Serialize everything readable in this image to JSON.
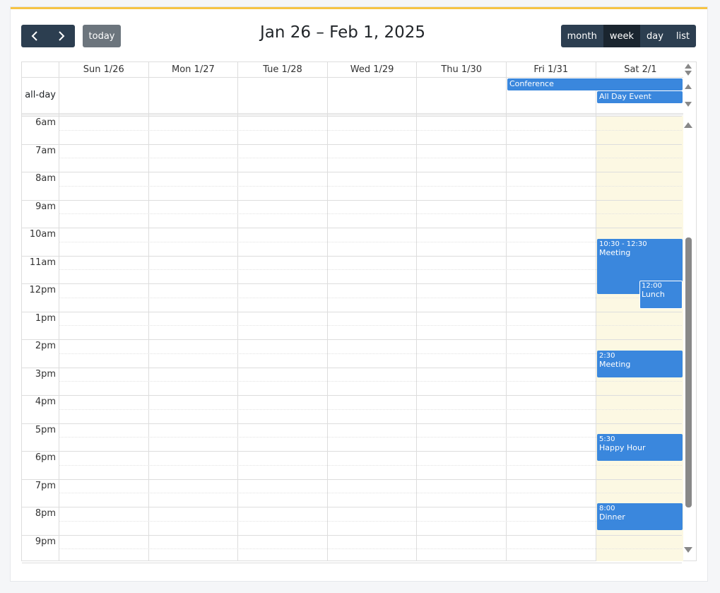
{
  "toolbar": {
    "title": "Jan 26 – Feb 1, 2025",
    "today_label": "today",
    "views": [
      "month",
      "week",
      "day",
      "list"
    ],
    "active_view": "week"
  },
  "columns": [
    "Sun 1/26",
    "Mon 1/27",
    "Tue 1/28",
    "Wed 1/29",
    "Thu 1/30",
    "Fri 1/31",
    "Sat 2/1"
  ],
  "allday_label": "all-day",
  "allday_events": [
    {
      "title": "Conference"
    },
    {
      "title": "All Day Event"
    }
  ],
  "times": [
    "6am",
    "7am",
    "8am",
    "9am",
    "10am",
    "11am",
    "12pm",
    "1pm",
    "2pm",
    "3pm",
    "4pm",
    "5pm",
    "6pm",
    "7pm",
    "8pm",
    "9pm"
  ],
  "events": [
    {
      "time": "10:30 - 12:30",
      "title": "Meeting"
    },
    {
      "time": "12:00",
      "title": "Lunch"
    },
    {
      "time": "2:30",
      "title": "Meeting"
    },
    {
      "time": "5:30",
      "title": "Happy Hour"
    },
    {
      "time": "8:00",
      "title": "Dinner"
    }
  ],
  "colors": {
    "accent": "#f6c344",
    "button": "#2c3e50",
    "event": "#3a87dd",
    "today": "#fcf8e3"
  }
}
